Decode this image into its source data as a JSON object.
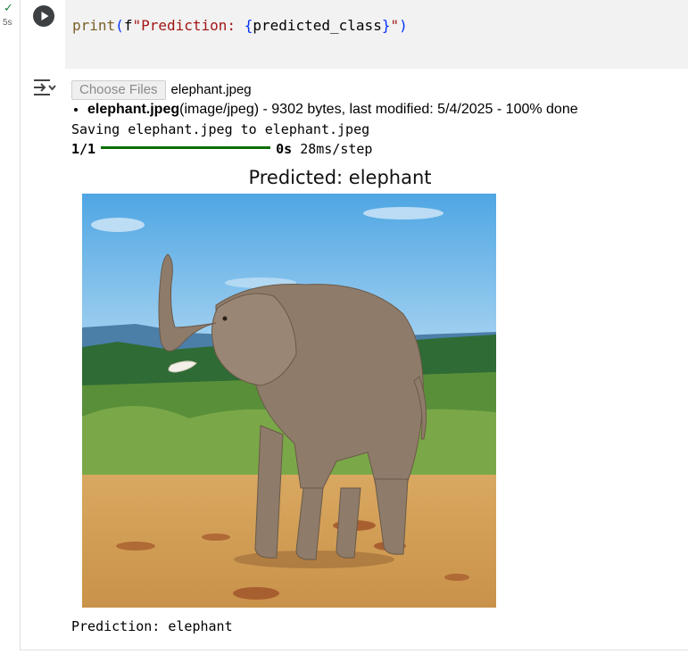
{
  "gutter": {
    "check_icon": "checkmark-icon",
    "exec_time": "5s"
  },
  "code": {
    "fn": "print",
    "open_paren": "(",
    "prefix": "f",
    "str_start": "\"Prediction: ",
    "brace_open": "{",
    "var": "predicted_class",
    "brace_close": "}",
    "str_end": "\"",
    "close_paren": ")"
  },
  "toolbar": {
    "run_icon": "play-icon",
    "output_icon": "output-toggle-icon"
  },
  "upload": {
    "button_label": "Choose Files",
    "selected_file": "elephant.jpeg",
    "list_name": "elephant.jpeg",
    "list_type": "(image/jpeg)",
    "list_details": " - 9302 bytes, last modified: 5/4/2025 - 100% done"
  },
  "saving_text": "Saving elephant.jpeg to elephant.jpeg",
  "progress": {
    "step": "1/1",
    "time": "0s",
    "rate": "28ms/step",
    "fraction": 1.0
  },
  "plot": {
    "title": "Predicted: elephant"
  },
  "prediction_text": "Prediction: elephant",
  "colors": {
    "check": "#188038",
    "progress": "#0a6e00",
    "code_bg": "#f2f2f2"
  }
}
